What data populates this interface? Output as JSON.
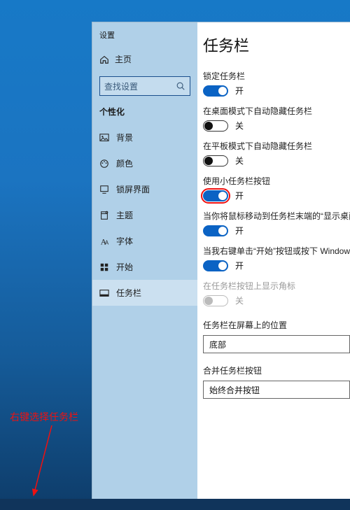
{
  "app_title": "设置",
  "home_label": "主页",
  "search_placeholder": "查找设置",
  "category": "个性化",
  "sidebar": {
    "items": [
      {
        "label": "背景",
        "icon": "picture"
      },
      {
        "label": "颜色",
        "icon": "palette"
      },
      {
        "label": "锁屏界面",
        "icon": "screen"
      },
      {
        "label": "主题",
        "icon": "theme"
      },
      {
        "label": "字体",
        "icon": "font"
      },
      {
        "label": "开始",
        "icon": "start"
      },
      {
        "label": "任务栏",
        "icon": "taskbar"
      }
    ]
  },
  "page_title": "任务栏",
  "options": [
    {
      "label": "锁定任务栏",
      "on": true,
      "state": "开",
      "disabled": false,
      "highlight": false
    },
    {
      "label": "在桌面模式下自动隐藏任务栏",
      "on": false,
      "state": "关",
      "disabled": false,
      "highlight": false
    },
    {
      "label": "在平板模式下自动隐藏任务栏",
      "on": false,
      "state": "关",
      "disabled": false,
      "highlight": false
    },
    {
      "label": "使用小任务栏按钮",
      "on": true,
      "state": "开",
      "disabled": false,
      "highlight": true
    },
    {
      "label": "当你将鼠标移动到任务栏末端的“显示桌面”按钮时，使用“速览”预览桌面",
      "on": true,
      "state": "开",
      "disabled": false,
      "highlight": false
    },
    {
      "label": "当我右键单击“开始”按钮或按下 Windows 键+X 时，在菜单中将命令提示符替换为 Windows PowerShell",
      "on": true,
      "state": "开",
      "disabled": false,
      "highlight": false
    },
    {
      "label": "在任务栏按钮上显示角标",
      "on": false,
      "state": "关",
      "disabled": true,
      "highlight": false
    }
  ],
  "position": {
    "label": "任务栏在屏幕上的位置",
    "value": "底部"
  },
  "combine": {
    "label": "合并任务栏按钮",
    "value": "始终合并按钮"
  },
  "annotation": "右键选择任务栏",
  "colors": {
    "accent": "#0b63c4",
    "hl": "#e11"
  }
}
